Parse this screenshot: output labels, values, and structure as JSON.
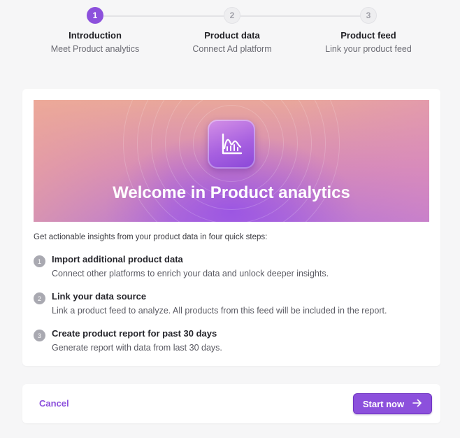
{
  "stepper": {
    "steps": [
      {
        "number": "1",
        "title": "Introduction",
        "subtitle": "Meet Product analytics",
        "state": "active"
      },
      {
        "number": "2",
        "title": "Product data",
        "subtitle": "Connect Ad platform",
        "state": "inactive"
      },
      {
        "number": "3",
        "title": "Product feed",
        "subtitle": "Link your product feed",
        "state": "inactive"
      }
    ]
  },
  "banner": {
    "icon": "chart-icon",
    "title": "Welcome in Product analytics"
  },
  "intro_text": "Get actionable insights from your product data in four quick steps:",
  "items": [
    {
      "number": "1",
      "title": "Import additional product data",
      "description": "Connect other platforms to enrich your data and unlock deeper insights."
    },
    {
      "number": "2",
      "title": "Link your data source",
      "description": "Link a product feed to analyze. All products from this feed will be included in the report."
    },
    {
      "number": "3",
      "title": "Create product report for past 30 days",
      "description": "Generate report with data from last 30 days."
    }
  ],
  "footer": {
    "cancel_label": "Cancel",
    "start_label": "Start now",
    "start_icon": "arrow-right-icon"
  },
  "colors": {
    "accent": "#8c50dc",
    "inactive_step": "#eeeef0"
  }
}
